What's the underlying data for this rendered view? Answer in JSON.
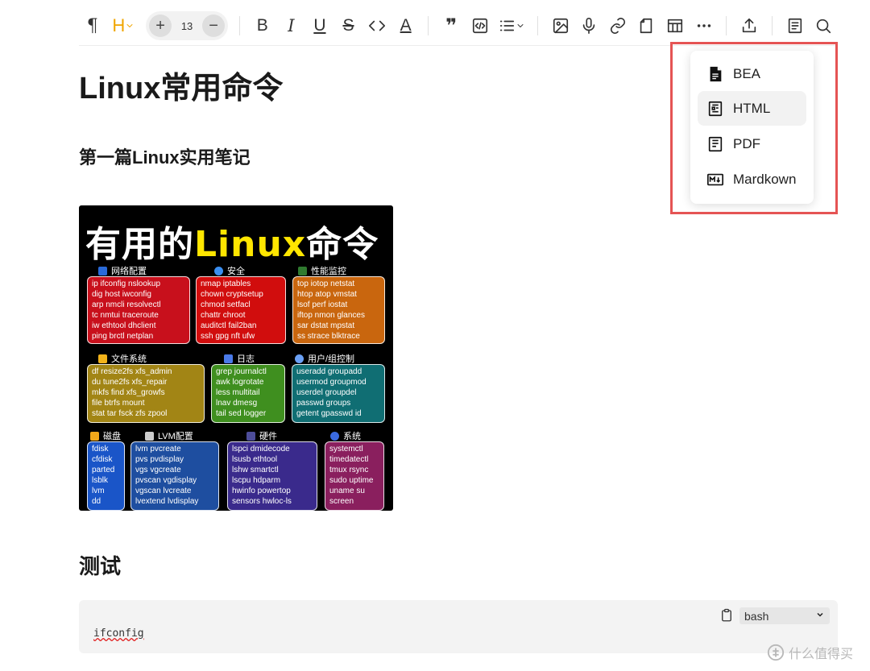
{
  "toolbar": {
    "paragraph_glyph": "¶",
    "heading_glyph": "H",
    "font_size_plus": "+",
    "font_size": "13",
    "font_size_minus": "−",
    "bold_glyph": "B",
    "italic_glyph": "I",
    "underline_glyph": "U",
    "strike_glyph": "S",
    "underline_a_glyph": "A",
    "quote_glyph": "❞"
  },
  "doc": {
    "title": "Linux常用命令",
    "subtitle": "第一篇Linux实用笔记",
    "section_title": "测试"
  },
  "poster": {
    "title_white": "有用的",
    "title_yellow": "Linux",
    "title_tail": "命令",
    "categories": [
      {
        "name": "网络配置",
        "color": "#c8101c",
        "lines": [
          "ip   ifconfig nslookup",
          "dig  host    iwconfig",
          "arp  nmcli   resolvectl",
          "tc   nmtui   traceroute",
          "iw   ethtool dhclient",
          "ping brctl   netplan"
        ]
      },
      {
        "name": "安全",
        "color": "#d10d0d",
        "lines": [
          "nmap    iptables",
          "chown   cryptsetup",
          "chmod   setfacl",
          "chattr  chroot",
          "auditctl fail2ban",
          "ssh gpg  nft  ufw"
        ]
      },
      {
        "name": "性能监控",
        "color": "#c9660e",
        "lines": [
          "top   iotop  netstat",
          "htop  atop   vmstat",
          "lsof  perf   iostat",
          "iftop nmon   glances",
          "sar   dstat  mpstat",
          "ss strace blktrace"
        ]
      },
      {
        "name": "文件系统",
        "color": "#a28515",
        "lines": [
          "df   resize2fs xfs_admin",
          "du   tune2fs   xfs_repair",
          "mkfs find      xfs_growfs",
          "file btrfs     mount",
          "stat tar fsck zfs  zpool"
        ]
      },
      {
        "name": "日志",
        "color": "#3f8f1f",
        "lines": [
          "grep journalctl",
          "awk  logrotate",
          "less multitail",
          "lnav dmesg",
          "tail sed logger"
        ]
      },
      {
        "name": "用户/组控制",
        "color": "#106e73",
        "lines": [
          "useradd  groupadd",
          "usermod  groupmod",
          "userdel  groupdel",
          "passwd   groups",
          "getent gpasswd id"
        ]
      },
      {
        "name": "磁盘",
        "color": "#1a55c8",
        "lines": [
          "fdisk",
          "cfdisk",
          "parted",
          "lsblk",
          "lvm",
          "dd"
        ]
      },
      {
        "name": "LVM配置",
        "color": "#1e4ea0",
        "lines": [
          "lvm      pvcreate",
          "pvs      pvdisplay",
          "vgs      vgcreate",
          "pvscan   vgdisplay",
          "vgscan   lvcreate",
          "lvextend lvdisplay"
        ]
      },
      {
        "name": "硬件",
        "color": "#3a2a8c",
        "lines": [
          "lspci   dmidecode",
          "lsusb   ethtool",
          "lshw    smartctl",
          "lscpu   hdparm",
          "hwinfo  powertop",
          "sensors hwloc-ls"
        ]
      },
      {
        "name": "系统",
        "color": "#8a1f5e",
        "lines": [
          "systemctl",
          "timedatectl",
          "tmux rsync",
          "sudo uptime",
          "uname su",
          "screen"
        ]
      }
    ]
  },
  "code_block": {
    "code": "ifconfig",
    "language": "bash"
  },
  "export_menu": {
    "items": [
      {
        "label": "BEA",
        "icon": "file-filled-icon"
      },
      {
        "label": "HTML",
        "icon": "html-doc-icon"
      },
      {
        "label": "PDF",
        "icon": "pdf-doc-icon"
      },
      {
        "label": "Mardkown",
        "icon": "markdown-icon"
      }
    ],
    "active_index": 1
  },
  "watermark": {
    "text": "什么值得买"
  },
  "colors": {
    "heading_accent": "#f0a500",
    "highlight_border": "#e55454"
  }
}
